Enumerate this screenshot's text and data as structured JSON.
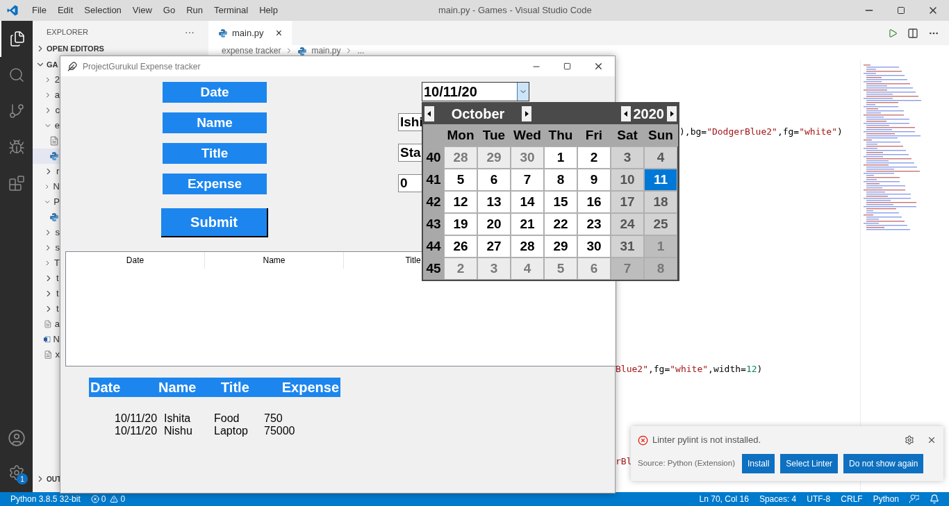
{
  "window": {
    "title": "main.py - Games - Visual Studio Code",
    "menu": [
      "File",
      "Edit",
      "Selection",
      "View",
      "Go",
      "Run",
      "Terminal",
      "Help"
    ]
  },
  "activity_bar": {
    "items": [
      {
        "kind": "files",
        "selected": true
      },
      {
        "kind": "search",
        "selected": false
      },
      {
        "kind": "source",
        "selected": false
      },
      {
        "kind": "debug",
        "selected": false
      },
      {
        "kind": "extensions",
        "selected": false
      }
    ],
    "settings_badge": "1"
  },
  "explorer": {
    "title": "EXPLORER",
    "more": "···",
    "sections": [
      {
        "label": "OPEN EDITORS",
        "expanded": false
      },
      {
        "label": "GA",
        "expanded": true
      }
    ],
    "items": [
      {
        "label": "2",
        "kind": "folder",
        "expanded": false,
        "selected": false
      },
      {
        "label": "a",
        "kind": "folder",
        "expanded": false,
        "selected": false
      },
      {
        "label": "c",
        "kind": "folder",
        "expanded": false,
        "selected": false
      },
      {
        "label": "e",
        "kind": "folder",
        "expanded": true,
        "selected": false,
        "children": [
          {
            "kind": "text",
            "selected": false
          },
          {
            "kind": "python",
            "selected": true
          }
        ]
      },
      {
        "label": "r",
        "kind": "folder",
        "expanded": false,
        "selected": false
      },
      {
        "label": "N",
        "kind": "folder",
        "expanded": false,
        "selected": false
      },
      {
        "label": "P",
        "kind": "folder",
        "expanded": true,
        "selected": false,
        "children": [
          {
            "kind": "python",
            "selected": false
          }
        ]
      },
      {
        "label": "s",
        "kind": "folder",
        "expanded": false,
        "selected": false
      },
      {
        "label": "s",
        "kind": "folder",
        "expanded": false,
        "selected": false
      },
      {
        "label": "T",
        "kind": "folder",
        "expanded": false,
        "selected": false
      },
      {
        "label": "t",
        "kind": "folder",
        "expanded": false,
        "selected": false
      },
      {
        "label": "t",
        "kind": "folder",
        "expanded": false,
        "selected": false
      },
      {
        "label": "t",
        "kind": "folder",
        "expanded": false,
        "selected": false
      },
      {
        "label": "a",
        "kind": "text",
        "selected": false
      },
      {
        "label": "N",
        "kind": "word",
        "selected": false
      },
      {
        "label": "x",
        "kind": "text",
        "selected": false
      }
    ],
    "bottom_section": {
      "label": "OUT",
      "expanded": false
    }
  },
  "editor": {
    "tab": {
      "label": "main.py",
      "close": "×"
    },
    "breadcrumb": [
      "expense tracker",
      "main.py",
      "..."
    ],
    "code_fragments": [
      {
        "parts": [
          {
            "text": "),bg=",
            "kind": "plain"
          },
          {
            "text": "\"DodgerBlue2\"",
            "kind": "string"
          },
          {
            "text": ",fg=",
            "kind": "plain"
          },
          {
            "text": "\"white\"",
            "kind": "string"
          },
          {
            "text": ")",
            "kind": "plain"
          }
        ]
      },
      {
        "parts": [
          {
            "text": "Blue2\"",
            "kind": "string"
          },
          {
            "text": ",fg=",
            "kind": "plain"
          },
          {
            "text": "\"white\"",
            "kind": "string"
          },
          {
            "text": ",width=",
            "kind": "plain"
          },
          {
            "text": "12",
            "kind": "number"
          },
          {
            "text": ")",
            "kind": "plain"
          }
        ]
      },
      {
        "parts": [
          {
            "text": "rBl",
            "kind": "string"
          }
        ]
      }
    ]
  },
  "app_window": {
    "title": "ProjectGurukul Expense tracker",
    "labels": [
      "Date",
      "Name",
      "Title",
      "Expense"
    ],
    "submit": "Submit",
    "entries": [
      "Ishi",
      "Sta",
      "0"
    ],
    "date_picker": {
      "value": "10/11/20"
    },
    "calendar": {
      "month": "October",
      "year": "2020",
      "weekdays": [
        "Mon",
        "Tue",
        "Wed",
        "Thu",
        "Fri",
        "Sat",
        "Sun"
      ],
      "weeks": [
        {
          "number": "40",
          "days": [
            {
              "text": "28",
              "kind": "out",
              "selected": false
            },
            {
              "text": "29",
              "kind": "out",
              "selected": false
            },
            {
              "text": "30",
              "kind": "out",
              "selected": false
            },
            {
              "text": "1",
              "kind": "day",
              "selected": false
            },
            {
              "text": "2",
              "kind": "day",
              "selected": false
            },
            {
              "text": "3",
              "kind": "weekend",
              "selected": false
            },
            {
              "text": "4",
              "kind": "weekend",
              "selected": false
            }
          ]
        },
        {
          "number": "41",
          "days": [
            {
              "text": "5",
              "kind": "day",
              "selected": false
            },
            {
              "text": "6",
              "kind": "day",
              "selected": false
            },
            {
              "text": "7",
              "kind": "day",
              "selected": false
            },
            {
              "text": "8",
              "kind": "day",
              "selected": false
            },
            {
              "text": "9",
              "kind": "day",
              "selected": false
            },
            {
              "text": "10",
              "kind": "weekend",
              "selected": false
            },
            {
              "text": "11",
              "kind": "weekend",
              "selected": true
            }
          ]
        },
        {
          "number": "42",
          "days": [
            {
              "text": "12",
              "kind": "day",
              "selected": false
            },
            {
              "text": "13",
              "kind": "day",
              "selected": false
            },
            {
              "text": "14",
              "kind": "day",
              "selected": false
            },
            {
              "text": "15",
              "kind": "day",
              "selected": false
            },
            {
              "text": "16",
              "kind": "day",
              "selected": false
            },
            {
              "text": "17",
              "kind": "weekend",
              "selected": false
            },
            {
              "text": "18",
              "kind": "weekend",
              "selected": false
            }
          ]
        },
        {
          "number": "43",
          "days": [
            {
              "text": "19",
              "kind": "day",
              "selected": false
            },
            {
              "text": "20",
              "kind": "day",
              "selected": false
            },
            {
              "text": "21",
              "kind": "day",
              "selected": false
            },
            {
              "text": "22",
              "kind": "day",
              "selected": false
            },
            {
              "text": "23",
              "kind": "day",
              "selected": false
            },
            {
              "text": "24",
              "kind": "weekend",
              "selected": false
            },
            {
              "text": "25",
              "kind": "weekend",
              "selected": false
            }
          ]
        },
        {
          "number": "44",
          "days": [
            {
              "text": "26",
              "kind": "day",
              "selected": false
            },
            {
              "text": "27",
              "kind": "day",
              "selected": false
            },
            {
              "text": "28",
              "kind": "day",
              "selected": false
            },
            {
              "text": "29",
              "kind": "day",
              "selected": false
            },
            {
              "text": "30",
              "kind": "day",
              "selected": false
            },
            {
              "text": "31",
              "kind": "weekend",
              "selected": false
            },
            {
              "text": "1",
              "kind": "out_weekend",
              "selected": false
            }
          ]
        },
        {
          "number": "45",
          "days": [
            {
              "text": "2",
              "kind": "out",
              "selected": false
            },
            {
              "text": "3",
              "kind": "out",
              "selected": false
            },
            {
              "text": "4",
              "kind": "out",
              "selected": false
            },
            {
              "text": "5",
              "kind": "out",
              "selected": false
            },
            {
              "text": "6",
              "kind": "out",
              "selected": false
            },
            {
              "text": "7",
              "kind": "out_weekend",
              "selected": false
            },
            {
              "text": "8",
              "kind": "out_weekend",
              "selected": false
            }
          ]
        }
      ]
    },
    "tree_columns": [
      "Date",
      "Name",
      "Title"
    ],
    "summary": {
      "columns": [
        "Date",
        "Name",
        "Title",
        "Expense"
      ],
      "rows": [
        [
          "10/11/20",
          "Ishita",
          "Food",
          "750"
        ],
        [
          "10/11/20",
          "Nishu",
          "Laptop",
          "75000"
        ]
      ]
    }
  },
  "notification": {
    "message": "Linter pylint is not installed.",
    "source": "Source: Python (Extension)",
    "buttons": [
      "Install",
      "Select Linter",
      "Do not show again"
    ]
  },
  "status_bar": {
    "interpreter": "Python 3.8.5 32-bit",
    "errors": "0",
    "warnings": "0",
    "right": [
      "Ln 70, Col 16",
      "Spaces: 4",
      "UTF-8",
      "CRLF",
      "Python"
    ]
  }
}
